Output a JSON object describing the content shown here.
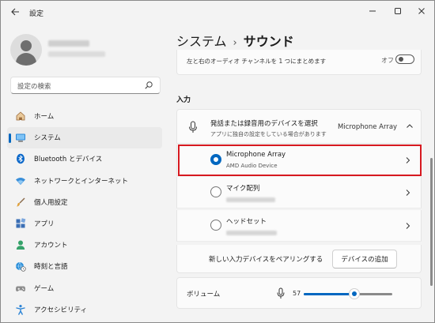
{
  "window": {
    "title": "設定",
    "back_icon": "back-arrow-icon",
    "controls": [
      "minimize-icon",
      "maximize-icon",
      "close-icon"
    ]
  },
  "search": {
    "placeholder": "設定の検索",
    "icon": "search-icon"
  },
  "sidebar": {
    "items": [
      {
        "label": "ホーム",
        "icon": "home-icon",
        "active": false
      },
      {
        "label": "システム",
        "icon": "system-monitor-icon",
        "active": true
      },
      {
        "label": "Bluetooth とデバイス",
        "icon": "bluetooth-icon",
        "active": false
      },
      {
        "label": "ネットワークとインターネット",
        "icon": "wifi-icon",
        "active": false
      },
      {
        "label": "個人用設定",
        "icon": "brush-icon",
        "active": false
      },
      {
        "label": "アプリ",
        "icon": "apps-icon",
        "active": false
      },
      {
        "label": "アカウント",
        "icon": "account-icon",
        "active": false
      },
      {
        "label": "時刻と言語",
        "icon": "globe-clock-icon",
        "active": false
      },
      {
        "label": "ゲーム",
        "icon": "gamepad-icon",
        "active": false
      },
      {
        "label": "アクセシビリティ",
        "icon": "accessibility-icon",
        "active": false
      }
    ]
  },
  "breadcrumb": {
    "parent": "システム",
    "separator": "›",
    "current": "サウンド"
  },
  "mono_audio": {
    "text": "左と右のオーディオ チャンネルを 1 つにまとめます",
    "state": "オフ",
    "on": false
  },
  "input_section": {
    "heading": "入力",
    "header_title": "発話または録音用のデバイスを選択",
    "header_subtitle": "アプリに独自の設定をしている場合があります",
    "selected_device": "Microphone Array",
    "devices": [
      {
        "name": "Microphone Array",
        "subtitle": "AMD Audio Device",
        "selected": true
      },
      {
        "name": "マイク配列",
        "subtitle": "",
        "selected": false
      },
      {
        "name": "ヘッドセット",
        "subtitle": "",
        "selected": false
      }
    ],
    "pair_text": "新しい入力デバイスをペアリングする",
    "add_button": "デバイスの追加",
    "volume_label": "ボリューム",
    "volume_value": "57",
    "volume_fraction": 0.57
  },
  "colors": {
    "accent": "#0067c0",
    "highlight": "#d71920"
  }
}
